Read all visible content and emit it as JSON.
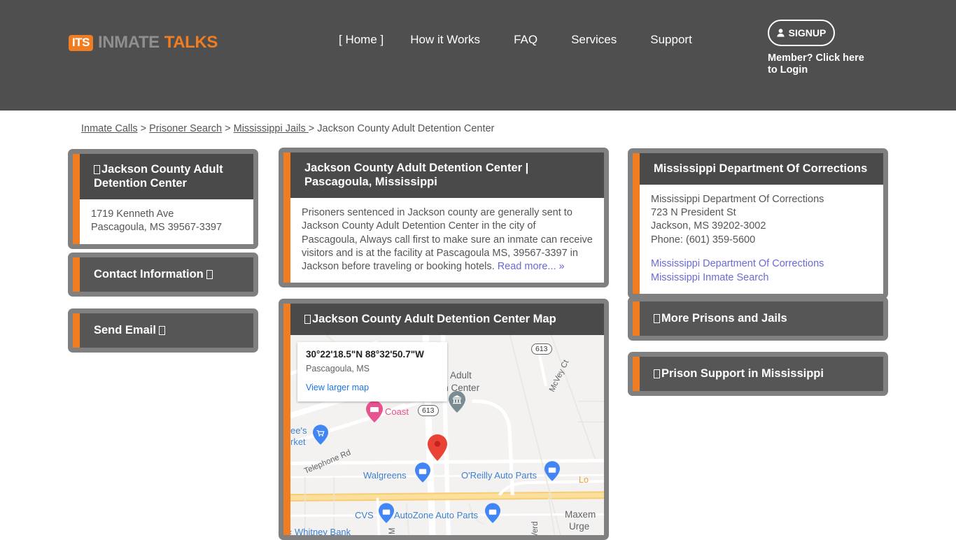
{
  "header": {
    "logo": {
      "badge": "ITS",
      "first": "INMATE",
      "second": "TALKS"
    },
    "nav": [
      {
        "name": "home",
        "label": "[  Home  ]"
      },
      {
        "name": "how-it-works",
        "label": "How it Works"
      },
      {
        "name": "faq",
        "label": "FAQ"
      },
      {
        "name": "services",
        "label": "Services"
      },
      {
        "name": "support",
        "label": "Support"
      }
    ],
    "signup_label": "SIGNUP",
    "member_login_label": "Member? Click here to Login"
  },
  "breadcrumb": {
    "items": [
      {
        "label": "Inmate Calls",
        "link": true
      },
      {
        "label": "Prisoner Search",
        "link": true
      },
      {
        "label": "Mississippi Jails ",
        "link": true
      },
      {
        "label": "Jackson County Adult Detention Center",
        "link": false
      }
    ],
    "separator": ">"
  },
  "left_column": {
    "facility": {
      "title": "Jackson County Adult Detention Center",
      "address_line1": "1719 Kenneth Ave",
      "address_line2": "Pascagoula, MS 39567-3397"
    },
    "contact_button": "Contact Information",
    "email_button": "Send Email"
  },
  "main": {
    "overview": {
      "title": "Jackson County Adult Detention Center | Pascagoula, Mississippi",
      "body": "Prisoners sentenced in Jackson county are generally sent to Jackson County Adult Detention Center in the city of Pascagoula, Always call first to make sure an inmate can receive visitors and is at the facility at Pascagoula MS, 39567-3397 in Jackson before traveling or booking hotels. ",
      "read_more": "Read more... »"
    },
    "map": {
      "title": "Jackson County Adult Detention Center Map",
      "coordinates": "30°22'18.5\"N 88°32'50.7\"W",
      "city": "Pascagoula, MS",
      "view_larger": "View larger map",
      "labels": [
        {
          "name": "map-label-lees-market",
          "text": "ee's",
          "kind": "poi"
        },
        {
          "name": "map-label-lees-market2",
          "text": "rket",
          "kind": "poi"
        },
        {
          "name": "map-label-coast",
          "text": "Coast",
          "kind": "pink"
        },
        {
          "name": "map-label-adult",
          "text": "Adult",
          "kind": "place"
        },
        {
          "name": "map-label-detention-center",
          "text": "Detention Center",
          "kind": "place"
        },
        {
          "name": "map-label-mcvey-ct",
          "text": "McVey Ct",
          "kind": "road"
        },
        {
          "name": "map-label-telephone-rd",
          "text": "Telephone Rd",
          "kind": "road"
        },
        {
          "name": "map-label-walgreens",
          "text": "Walgreens",
          "kind": "poi"
        },
        {
          "name": "map-label-oreilly",
          "text": "O'Reilly Auto Parts",
          "kind": "poi"
        },
        {
          "name": "map-label-cvs",
          "text": "CVS",
          "kind": "poi"
        },
        {
          "name": "map-label-autozone",
          "text": "AutoZone Auto Parts",
          "kind": "poi"
        },
        {
          "name": "map-label-whitney-bank",
          "text": "Whitney Bank",
          "kind": "poi"
        },
        {
          "name": "map-label-maxem",
          "text": "Maxem",
          "kind": "place"
        },
        {
          "name": "map-label-urgent",
          "text": "Urge",
          "kind": "place"
        },
        {
          "name": "map-label-verd",
          "text": "Verd",
          "kind": "road"
        },
        {
          "name": "map-label-lo",
          "text": "Lo",
          "kind": "orange"
        },
        {
          "name": "map-label-m",
          "text": "M",
          "kind": "road"
        },
        {
          "name": "map-shield-613-top",
          "text": "613"
        },
        {
          "name": "map-shield-613-mid",
          "text": "613"
        }
      ]
    }
  },
  "right_column": {
    "mdoc": {
      "title": "Mississippi Department Of Corrections",
      "line1": "Mississippi Department Of Corrections",
      "line2": "723 N President St",
      "line3": "Jackson, MS 39202-3002",
      "line4": "Phone: (601) 359-5600",
      "link1": "Mississippi Department Of Corrections",
      "link2": "Mississippi Inmate Search"
    },
    "more_prisons_button": "More Prisons and Jails",
    "prison_support_button": "Prison Support in Mississippi"
  },
  "colors": {
    "accent_orange": "#f07d21",
    "header_gray": "#4f4f4f",
    "card_frame": "#808080",
    "card_head": "#4a4a4a",
    "link_purple": "#6a6ad4"
  }
}
